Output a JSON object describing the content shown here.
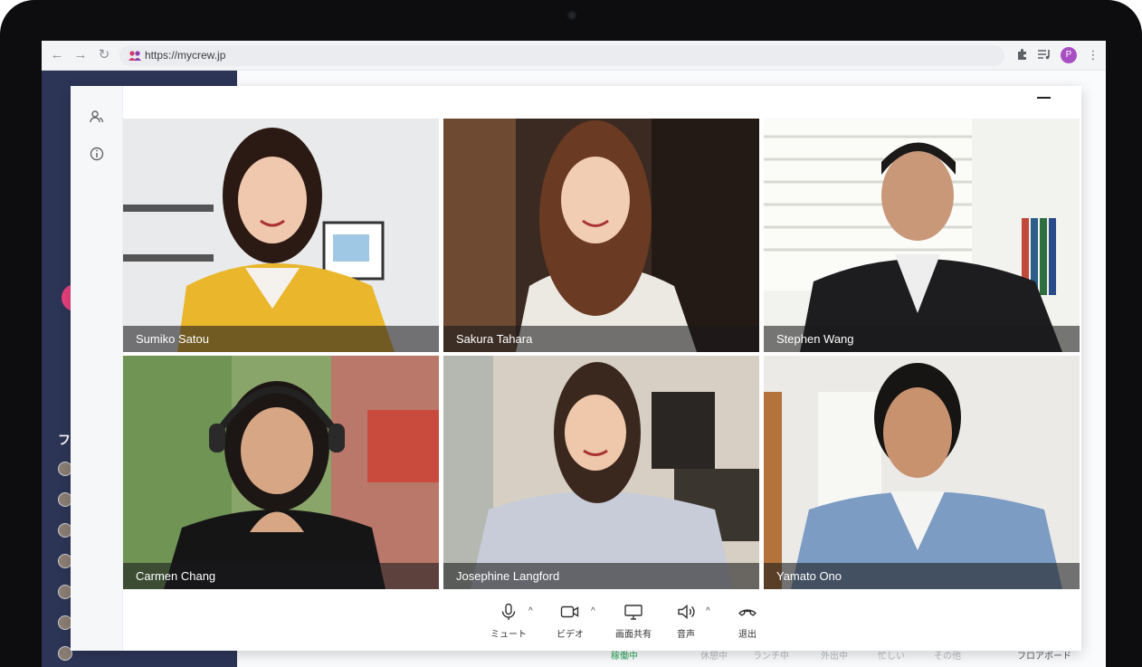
{
  "browser": {
    "url": "https://mycrew.jp",
    "profile_initial": "P"
  },
  "app": {
    "sidebar_label": "フ",
    "bottom_statuses": [
      {
        "label": "稼働中",
        "active": true
      },
      {
        "label": "休憩中",
        "active": false
      },
      {
        "label": "ランチ中",
        "active": false
      },
      {
        "label": "外出中",
        "active": false
      },
      {
        "label": "忙しい",
        "active": false
      },
      {
        "label": "その他",
        "active": false
      }
    ],
    "floor_label": "フロアボード"
  },
  "meeting": {
    "participants": [
      {
        "name": "Sumiko Satou"
      },
      {
        "name": "Sakura Tahara"
      },
      {
        "name": "Stephen Wang"
      },
      {
        "name": "Carmen Chang"
      },
      {
        "name": "Josephine Langford"
      },
      {
        "name": "Yamato Ono"
      }
    ],
    "controls": [
      {
        "label": "ミュート",
        "icon": "microphone-icon",
        "has_menu": true
      },
      {
        "label": "ビデオ",
        "icon": "video-camera-icon",
        "has_menu": true
      },
      {
        "label": "画面共有",
        "icon": "screen-share-icon",
        "has_menu": false
      },
      {
        "label": "音声",
        "icon": "speaker-icon",
        "has_menu": true
      },
      {
        "label": "退出",
        "icon": "hang-up-icon",
        "has_menu": false
      }
    ]
  },
  "colors": {
    "sidebar": "#2d3557",
    "accent_pink": "#e6407d",
    "active_status": "#2aa55a"
  }
}
